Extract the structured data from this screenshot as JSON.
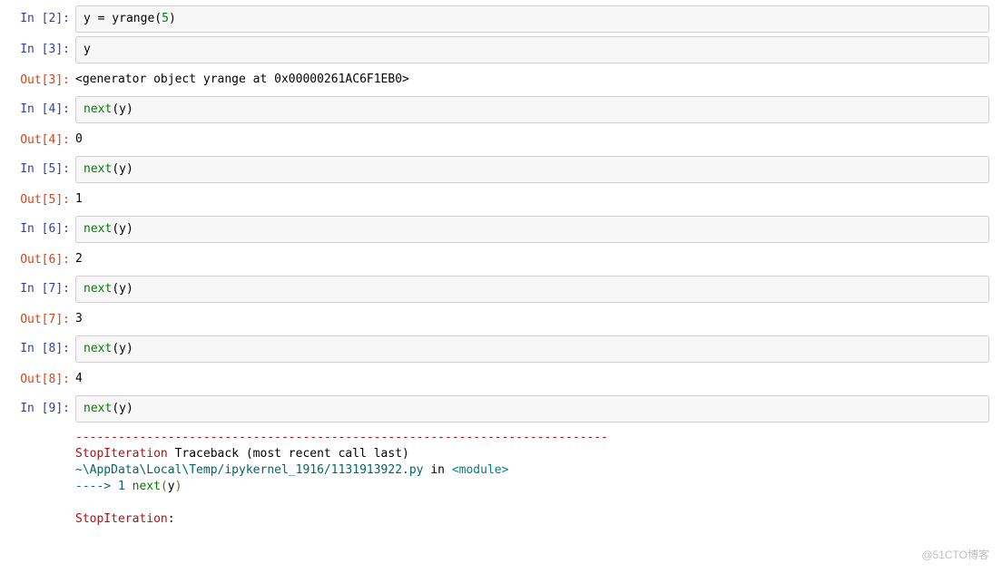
{
  "cells": [
    {
      "type": "in",
      "n": 2,
      "code_html": "y <span class='pn'>=</span> yrange(<span class='kw'>5</span>)"
    },
    {
      "type": "in",
      "n": 3,
      "code_html": "y"
    },
    {
      "type": "out",
      "n": 3,
      "text": "<generator object yrange at 0x00000261AC6F1EB0>"
    },
    {
      "type": "in",
      "n": 4,
      "code_html": "<span class='kw'>next</span>(y)"
    },
    {
      "type": "out",
      "n": 4,
      "text": "0"
    },
    {
      "type": "in",
      "n": 5,
      "code_html": "<span class='kw'>next</span>(y)"
    },
    {
      "type": "out",
      "n": 5,
      "text": "1"
    },
    {
      "type": "in",
      "n": 6,
      "code_html": "<span class='kw'>next</span>(y)"
    },
    {
      "type": "out",
      "n": 6,
      "text": "2"
    },
    {
      "type": "in",
      "n": 7,
      "code_html": "<span class='kw'>next</span>(y)"
    },
    {
      "type": "out",
      "n": 7,
      "text": "3"
    },
    {
      "type": "in",
      "n": 8,
      "code_html": "<span class='kw'>next</span>(y)"
    },
    {
      "type": "out",
      "n": 8,
      "text": "4"
    },
    {
      "type": "in",
      "n": 9,
      "code_html": "<span class='kw'>next</span>(y)"
    },
    {
      "type": "traceback",
      "lines_html": [
        "<span class='tr-dash'>---------------------------------------------------------------------------</span>",
        "<span class='ansi-red'>StopIteration</span>                             Traceback (most recent call last)",
        "<span class='ansi-green'>~\\AppData\\Local\\Temp/ipykernel_1916/1131913922.py</span> in <span class='ansi-cyan'>&lt;module&gt;</span>",
        "<span class='ansi-green'>----&gt; 1</span><span class='ansi-yellow'> </span><span class='kw'>next</span><span class='ansi-yellow'>(</span>y<span class='ansi-yellow'>)</span>",
        "",
        "<span class='ansi-red'>StopIteration</span>: "
      ]
    }
  ],
  "labels": {
    "in_prefix": "In [",
    "out_prefix": "Out[",
    "suffix": "]:"
  },
  "watermark": "@51CTO博客"
}
